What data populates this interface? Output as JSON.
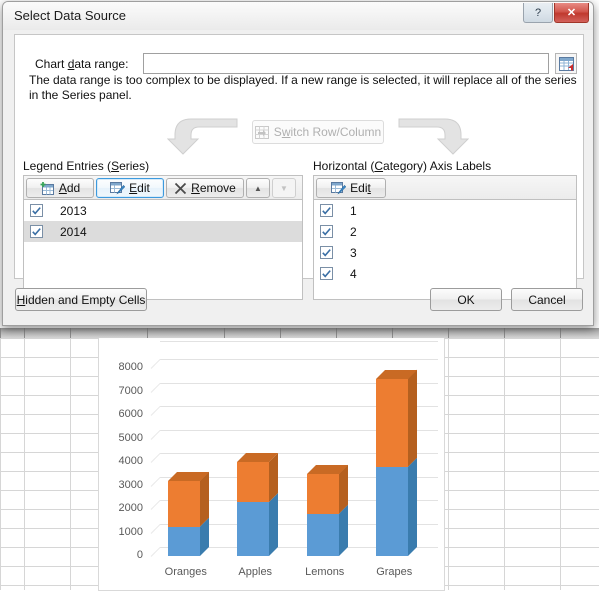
{
  "dialog": {
    "title": "Select Data Source",
    "help_label": "?",
    "close_label": "✕",
    "chart_data_range_label_pre": "Chart ",
    "chart_data_range_label_key": "d",
    "chart_data_range_label_post": "ata range:",
    "chart_data_range_value": "",
    "chart_data_range_placeholder": "",
    "range_picker_icon": "collapse-dialog-icon",
    "note": "The data range is too complex to be displayed. If a new range is selected, it will replace all of the series in the Series panel.",
    "switch_button_label_pre": "S",
    "switch_button_label_key": "w",
    "switch_button_label_post": "itch Row/Column",
    "switch_button_icon": "switch-row-column-icon",
    "left_arrow_icon": "curved-arrow-left-icon",
    "right_arrow_icon": "curved-arrow-right-icon"
  },
  "legend_panel": {
    "title_pre": "Legend Entries (",
    "title_key": "S",
    "title_post": "eries)",
    "buttons": [
      {
        "name": "add-button",
        "icon": "add-table-icon",
        "pre": "",
        "key": "A",
        "post": "dd",
        "state": "normal"
      },
      {
        "name": "edit-button",
        "icon": "edit-table-icon",
        "pre": "",
        "key": "E",
        "post": "dit",
        "state": "selected"
      },
      {
        "name": "remove-button",
        "icon": "remove-x-icon",
        "pre": "",
        "key": "R",
        "post": "emove",
        "state": "normal"
      }
    ],
    "move_up_label": "▲",
    "move_down_label": "▼",
    "items": [
      {
        "label": "2013",
        "checked": true,
        "selected": false
      },
      {
        "label": "2014",
        "checked": true,
        "selected": true
      }
    ]
  },
  "category_panel": {
    "title_pre": "Horizontal (",
    "title_key": "C",
    "title_post": "ategory) Axis Labels",
    "edit_pre": "Edi",
    "edit_key": "t",
    "edit_post": "",
    "edit_icon": "edit-table-icon",
    "items": [
      {
        "label": "1",
        "checked": true
      },
      {
        "label": "2",
        "checked": true
      },
      {
        "label": "3",
        "checked": true
      },
      {
        "label": "4",
        "checked": true
      }
    ]
  },
  "footer": {
    "hidden_cells_pre": "",
    "hidden_cells_key": "H",
    "hidden_cells_post": "idden and Empty Cells",
    "ok_label": "OK",
    "cancel_label": "Cancel"
  },
  "colors": {
    "series_2013": "#5B9BD5",
    "series_2014": "#ED7D31",
    "series_2013_side": "#3A7CAE",
    "series_2014_side": "#B5601F",
    "series_2013_top": "#4E89BF",
    "series_2014_top": "#C96A24",
    "gridline": "#E2E2E2",
    "axis_text": "#595959",
    "close_button": "#C0392E",
    "accent_selected": "#3C9ADE"
  },
  "chart_data": {
    "type": "bar",
    "subtype": "stacked-column-3d",
    "title": "",
    "xlabel": "",
    "ylabel": "",
    "categories": [
      "Oranges",
      "Apples",
      "Lemons",
      "Grapes"
    ],
    "series": [
      {
        "name": "2013",
        "values": [
          1250,
          2300,
          1800,
          3800
        ],
        "color": "#5B9BD5"
      },
      {
        "name": "2014",
        "values": [
          1950,
          1700,
          1700,
          3750
        ],
        "color": "#ED7D31"
      }
    ],
    "totals": [
      3200,
      4000,
      3500,
      7550
    ],
    "ylim": [
      0,
      8000
    ],
    "yticks": [
      0,
      1000,
      2000,
      3000,
      4000,
      5000,
      6000,
      7000,
      8000
    ],
    "ytick_labels": [
      "0",
      "1000",
      "2000",
      "3000",
      "4000",
      "5000",
      "6000",
      "7000",
      "8000"
    ],
    "grid": true,
    "legend": false,
    "legend_position": "none"
  }
}
